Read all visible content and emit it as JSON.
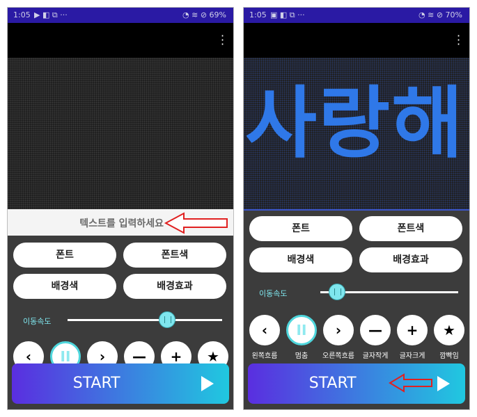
{
  "left_screen": {
    "status": {
      "time": "1:05",
      "battery": "69%"
    },
    "led_text": "",
    "input_placeholder": "텍스트를 입력하세요",
    "buttons": {
      "font": "폰트",
      "font_color": "폰트색",
      "bg_color": "배경색",
      "bg_effect": "배경효과"
    },
    "speed_label": "이동속도",
    "speed_value": 0.7,
    "controls": [
      "‹",
      "II",
      "›",
      "—",
      "+",
      "★"
    ],
    "start_label": "START"
  },
  "right_screen": {
    "status": {
      "time": "1:05",
      "battery": "70%"
    },
    "led_text": "사랑해",
    "buttons": {
      "font": "폰트",
      "font_color": "폰트색",
      "bg_color": "배경색",
      "bg_effect": "배경효과"
    },
    "speed_label": "이동속도",
    "speed_value": 0.1,
    "controls": [
      "‹",
      "II",
      "›",
      "—",
      "+",
      "★"
    ],
    "control_labels": [
      "왼쪽흐름",
      "멈춤",
      "오른쪽흐름",
      "글자작게",
      "글자크게",
      "깜빡임"
    ],
    "start_label": "START"
  },
  "colors": {
    "accent_cyan": "#7fe6ee",
    "led_blue": "#2f78e8",
    "annotation_red": "#e02020",
    "status_bar": "#2a1aa4"
  }
}
